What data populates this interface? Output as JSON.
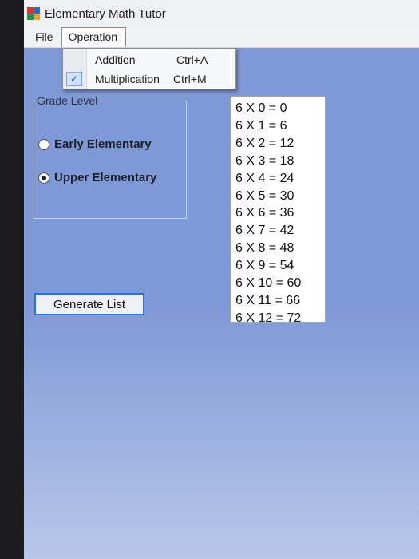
{
  "window": {
    "title": "Elementary Math Tutor"
  },
  "menubar": {
    "file": "File",
    "operation": "Operation"
  },
  "dropdown": {
    "items": [
      {
        "label": "Addition",
        "shortcut": "Ctrl+A",
        "checked": false
      },
      {
        "label": "Multiplication",
        "shortcut": "Ctrl+M",
        "checked": true
      }
    ]
  },
  "grade_level": {
    "title": "Grade Level",
    "options": [
      {
        "label": "Early Elementary",
        "selected": false
      },
      {
        "label": "Upper Elementary",
        "selected": true
      }
    ]
  },
  "results": [
    "6 X 0 = 0",
    "6 X 1 = 6",
    "6 X 2 = 12",
    "6 X 3 = 18",
    "6 X 4 = 24",
    "6 X 5 = 30",
    "6 X 6 = 36",
    "6 X 7 = 42",
    "6 X 8 = 48",
    "6 X 9 = 54",
    "6 X 10 = 60",
    "6 X 11 = 66",
    "6 X 12 = 72"
  ],
  "generate_button": {
    "label": "Generate List"
  },
  "colors": {
    "form_bg": "#7f98d6",
    "button_border": "#2f6fd6"
  }
}
